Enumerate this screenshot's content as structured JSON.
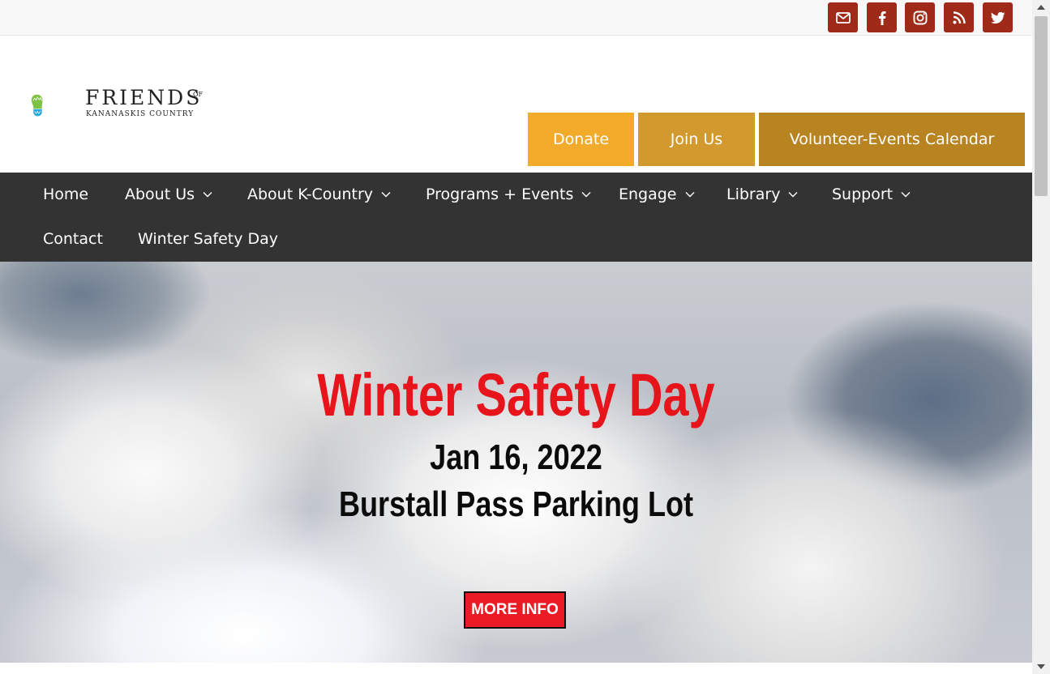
{
  "social": {
    "items": [
      {
        "name": "email",
        "icon": "envelope-icon"
      },
      {
        "name": "facebook",
        "icon": "facebook-icon"
      },
      {
        "name": "instagram",
        "icon": "instagram-icon"
      },
      {
        "name": "rss",
        "icon": "rss-icon"
      },
      {
        "name": "twitter",
        "icon": "twitter-icon"
      }
    ],
    "color": "#9e2a17"
  },
  "logo": {
    "line1": "FRIENDS",
    "of": "OF",
    "line2": "KANANASKIS COUNTRY"
  },
  "header_buttons": {
    "donate": "Donate",
    "join": "Join Us",
    "calendar": "Volunteer-Events Calendar",
    "colors": [
      "#f2aa2a",
      "#d29a2e",
      "#b88422"
    ]
  },
  "nav": {
    "items": [
      {
        "label": "Home",
        "dropdown": false
      },
      {
        "label": "About Us",
        "dropdown": true
      },
      {
        "label": "About K-Country",
        "dropdown": true
      },
      {
        "label": "Programs + Events",
        "dropdown": true
      },
      {
        "label": "Engage",
        "dropdown": true
      },
      {
        "label": "Library",
        "dropdown": true
      },
      {
        "label": "Support",
        "dropdown": true
      },
      {
        "label": "Contact",
        "dropdown": false
      },
      {
        "label": "Winter Safety Day",
        "dropdown": false
      }
    ],
    "background": "#333333"
  },
  "hero": {
    "title": "Winter Safety Day",
    "date": "Jan 16, 2022",
    "location": "Burstall Pass Parking Lot",
    "button": "MORE INFO",
    "title_color": "#e8141c",
    "button_color": "#ea1b24"
  }
}
